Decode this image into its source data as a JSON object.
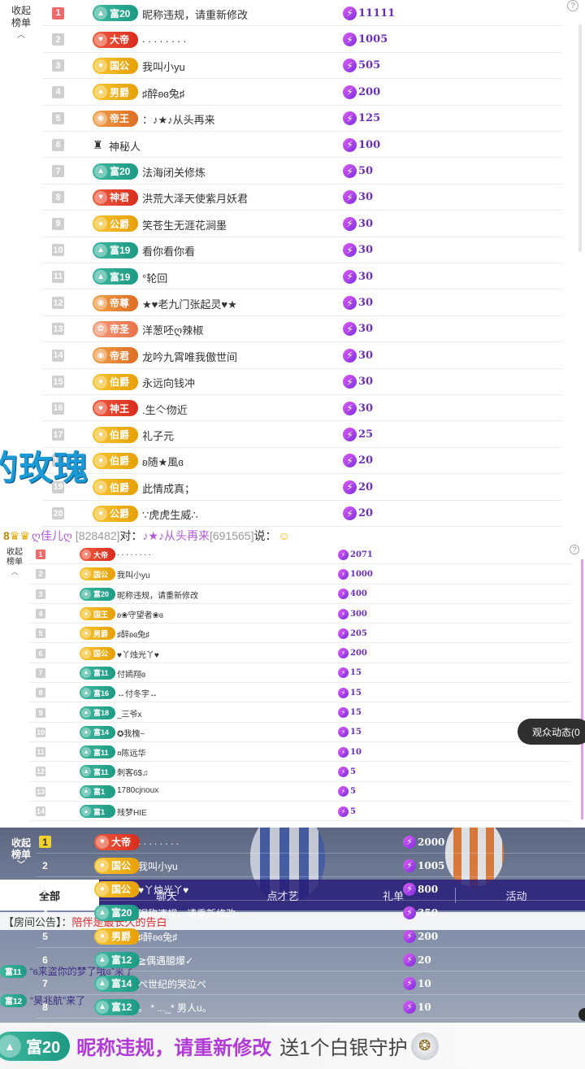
{
  "panel1": {
    "collapse_label": "收起\n榜单",
    "collapse_icon": "chevron-up-icon",
    "help_icon": "question-icon",
    "rows": [
      {
        "rank": "1",
        "badge": "富20",
        "badge_color": "teal",
        "nick": "昵称违规，请重新修改",
        "score": "11111"
      },
      {
        "rank": "2",
        "badge": "大帝",
        "badge_color": "red",
        "nick": ". . . . . . . .",
        "score": "1005"
      },
      {
        "rank": "3",
        "badge": "国公",
        "badge_color": "gold",
        "nick": "我叫小yu",
        "score": "505"
      },
      {
        "rank": "4",
        "badge": "男爵",
        "badge_color": "gold",
        "nick": "♯醉ʚɞ兔♯",
        "score": "200"
      },
      {
        "rank": "5",
        "badge": "帝王",
        "badge_color": "orange",
        "nick": "：♪★♪从头再来",
        "score": "125"
      },
      {
        "rank": "6",
        "badge": "",
        "badge_color": "none",
        "nick": "神秘人",
        "score": "100"
      },
      {
        "rank": "7",
        "badge": "富20",
        "badge_color": "teal",
        "nick": "法海闭关修炼",
        "score": "50"
      },
      {
        "rank": "8",
        "badge": "神君",
        "badge_color": "red",
        "nick": "洪荒大泽天使紫月妖君",
        "score": "30"
      },
      {
        "rank": "9",
        "badge": "公爵",
        "badge_color": "gold",
        "nick": "笑苍生无涯花涧墨",
        "score": "30"
      },
      {
        "rank": "10",
        "badge": "富19",
        "badge_color": "teal",
        "nick": "看你看你看",
        "score": "30"
      },
      {
        "rank": "11",
        "badge": "富19",
        "badge_color": "teal",
        "nick": "°轮回",
        "score": "30"
      },
      {
        "rank": "12",
        "badge": "帝尊",
        "badge_color": "orange",
        "nick": "★♥老九门张起灵♥★",
        "score": "30"
      },
      {
        "rank": "13",
        "badge": "帝圣",
        "badge_color": "pink",
        "nick": "洋葱呸ღ辣椒",
        "score": "30"
      },
      {
        "rank": "14",
        "badge": "帝君",
        "badge_color": "orange",
        "nick": "龙吟九霄唯我傲世间",
        "score": "30"
      },
      {
        "rank": "15",
        "badge": "伯爵",
        "badge_color": "gold",
        "nick": "永远向钱冲",
        "score": "30"
      },
      {
        "rank": "16",
        "badge": "神王",
        "badge_color": "red",
        "nick": ".生亽伆近",
        "score": "30"
      },
      {
        "rank": "17",
        "badge": "伯爵",
        "badge_color": "gold",
        "nick": "礼子元",
        "score": "25"
      },
      {
        "rank": "18",
        "badge": "伯爵",
        "badge_color": "gold",
        "nick": "ʚ随★風ɞ",
        "score": "20"
      },
      {
        "rank": "19",
        "badge": "伯爵",
        "badge_color": "gold",
        "nick": "此情成真；",
        "score": "20"
      },
      {
        "rank": "20",
        "badge": "公爵",
        "badge_color": "gold",
        "nick": "∵虎虎生威∴",
        "score": "20"
      }
    ],
    "overlay_text": "的玫瑰"
  },
  "chat_line": {
    "prefix": "8",
    "user": "ღ佳儿ღ",
    "id1": "[828482]",
    "to": "对：",
    "target": "♪★♪从头再来",
    "id2": "[691565]",
    "say": "说："
  },
  "panel2": {
    "collapse_label": "收起\n榜单",
    "rows": [
      {
        "rank": "1",
        "badge": "大帝",
        "badge_color": "red",
        "nick": ". . . . . . . .",
        "score": "2071"
      },
      {
        "rank": "2",
        "badge": "国公",
        "badge_color": "gold",
        "nick": "我叫小yu",
        "score": "1000"
      },
      {
        "rank": "3",
        "badge": "富20",
        "badge_color": "teal",
        "nick": "昵称违规，请重新修改",
        "score": "400"
      },
      {
        "rank": "4",
        "badge": "国王",
        "badge_color": "gold",
        "nick": "ʚ❀守望者❀ɞ",
        "score": "300"
      },
      {
        "rank": "5",
        "badge": "男爵",
        "badge_color": "gold",
        "nick": "♯醉ʚɞ兔♯",
        "score": "205"
      },
      {
        "rank": "6",
        "badge": "国公",
        "badge_color": "gold",
        "nick": "♥丫烛光丫♥",
        "score": "200"
      },
      {
        "rank": "7",
        "badge": "富11",
        "badge_color": "teal",
        "nick": "付嫣翔ɞ",
        "score": "15"
      },
      {
        "rank": "8",
        "badge": "富16",
        "badge_color": "teal",
        "nick": "↔付冬宇↔",
        "score": "15"
      },
      {
        "rank": "9",
        "badge": "富18",
        "badge_color": "teal",
        "nick": "_三爷x",
        "score": "15"
      },
      {
        "rank": "10",
        "badge": "富14",
        "badge_color": "teal",
        "nick": "✪我槐~",
        "score": "15"
      },
      {
        "rank": "11",
        "badge": "富11",
        "badge_color": "teal",
        "nick": "¤陈远华",
        "score": "10"
      },
      {
        "rank": "12",
        "badge": "富11",
        "badge_color": "teal",
        "nick": "刺客6$♫",
        "score": "5"
      },
      {
        "rank": "13",
        "badge": "富1",
        "badge_color": "teal",
        "nick": "1780cjnoux",
        "score": "5"
      },
      {
        "rank": "14",
        "badge": "富1",
        "badge_color": "teal",
        "nick": "残梦HIE",
        "score": "5"
      }
    ],
    "viewer_button": "观众动态(0"
  },
  "panel3": {
    "collapse_label": "收起\n榜单",
    "rows": [
      {
        "rank": "1",
        "badge": "大帝",
        "badge_color": "red",
        "nick": ". . . . . . . .",
        "score": "2000"
      },
      {
        "rank": "2",
        "badge": "国公",
        "badge_color": "gold",
        "nick": "我叫小yu",
        "score": "1005"
      },
      {
        "rank": "3",
        "badge": "国公",
        "badge_color": "gold",
        "nick": "♥丫烛光丫♥",
        "score": "800"
      },
      {
        "rank": "4",
        "badge": "富20",
        "badge_color": "teal",
        "nick": "昵称违规，请重新修改",
        "score": "350"
      },
      {
        "rank": "5",
        "badge": "男爵",
        "badge_color": "gold",
        "nick": "♯醉ʚɞ兔♯",
        "score": "200"
      },
      {
        "rank": "6",
        "badge": "富12",
        "badge_color": "teal",
        "nick": "≧偶遇臆爆✓",
        "score": "20"
      },
      {
        "rank": "7",
        "badge": "富14",
        "badge_color": "teal",
        "nick": "ぺ世纪的哭泣ぺ",
        "score": "10"
      },
      {
        "rank": "8",
        "badge": "富12",
        "badge_color": "teal",
        "nick": "。 * ..._* 男人u。",
        "score": "10"
      }
    ],
    "tabs": [
      "全部",
      "聊天",
      "点才艺",
      "礼单",
      "活动"
    ],
    "notice_label": "【房间公告】：",
    "notice_text": "陪伴是最长久的告白",
    "bg_msgs": [
      {
        "badge": "富11",
        "text": "“ɞ来盗你的梦了哦ɞ”来了"
      },
      {
        "badge": "富12",
        "text": "“昊兆航”来了"
      }
    ]
  },
  "gift_banner": {
    "badge": "富20",
    "nick": "昵称违规，请重新修改",
    "action": "送1个白银守护"
  }
}
